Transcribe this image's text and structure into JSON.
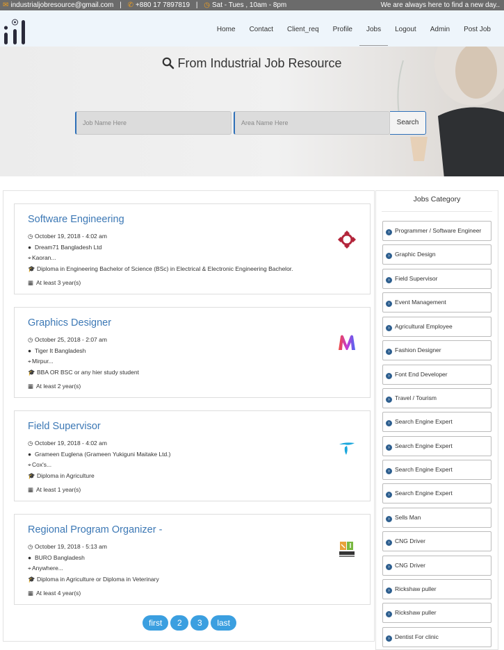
{
  "topbar": {
    "email": "industrialjobresource@gmail.com",
    "phone": "+880 17 7897819",
    "hours": "Sat - Tues , 10am - 8pm",
    "tagline": "We are always here to find a new day.."
  },
  "nav": {
    "items": [
      "Home",
      "Contact",
      "Client_req",
      "Profile",
      "Jobs",
      "Logout",
      "Admin",
      "Post Job"
    ],
    "active": "Jobs"
  },
  "hero": {
    "title": "From Industrial Job Resource",
    "job_placeholder": "Job Name Here",
    "area_placeholder": "Area Name Here",
    "search_label": "Search"
  },
  "jobs": [
    {
      "title": "Software Engineering",
      "date": "October 19, 2018 - 4:02 am",
      "company": "Dream71 Bangladesh Ltd",
      "location": "Kaoran...",
      "education": "Diploma in Engineering Bachelor of Science (BSc) in Electrical & Electronic Engineering Bachelor.",
      "experience": "At least 3 year(s)",
      "logo_icon": "dream71-logo"
    },
    {
      "title": "Graphics Designer",
      "date": "October 25, 2018 - 2:07 am",
      "company": "Tiger It Bangladesh",
      "location": "Mirpur...",
      "education": "BBA OR BSC or any hier study student",
      "experience": "At least 2 year(s)",
      "logo_icon": "tiger-it-logo"
    },
    {
      "title": "Field Supervisor",
      "date": "October 19, 2018 - 4:02 am",
      "company": "Grameen Euglena (Grameen Yukiguni Maitake Ltd.)",
      "location": "Cox's...",
      "education": "Diploma in Agriculture",
      "experience": "At least 1 year(s)",
      "logo_icon": "grameen-logo"
    },
    {
      "title": "Regional Program Organizer -",
      "date": "October 19, 2018 - 5:13 am",
      "company": "BURO Bangladesh",
      "location": "Anywhere...",
      "education": "Diploma in Agriculture or Diploma in Veterinary",
      "experience": "At least 4 year(s)",
      "logo_icon": "buro-logo"
    }
  ],
  "pagination": [
    "first",
    "2",
    "3",
    "last"
  ],
  "sidebar": {
    "title": "Jobs Category",
    "categories": [
      "Programmer / Software Engineer",
      "Graphic Design",
      "Field Supervisor",
      "Event Management",
      "Agricultural Employee",
      "Fashion Designer",
      "Font End Developer",
      "Travel / Tourism",
      "Search Engine Expert",
      "Search Engine Expert",
      "Search Engine Expert",
      "Search Engine Expert",
      "Sells Man",
      "CNG Driver",
      "CNG Driver",
      "Rickshaw puller",
      "Rickshaw puller",
      "Dentist For clinic"
    ]
  },
  "colors": {
    "accent": "#3c78b5",
    "topbar": "#6b6b6b",
    "topbar_icon": "#f0a020",
    "page_button": "#3b9fe0",
    "navbar": "#eef5fb"
  }
}
